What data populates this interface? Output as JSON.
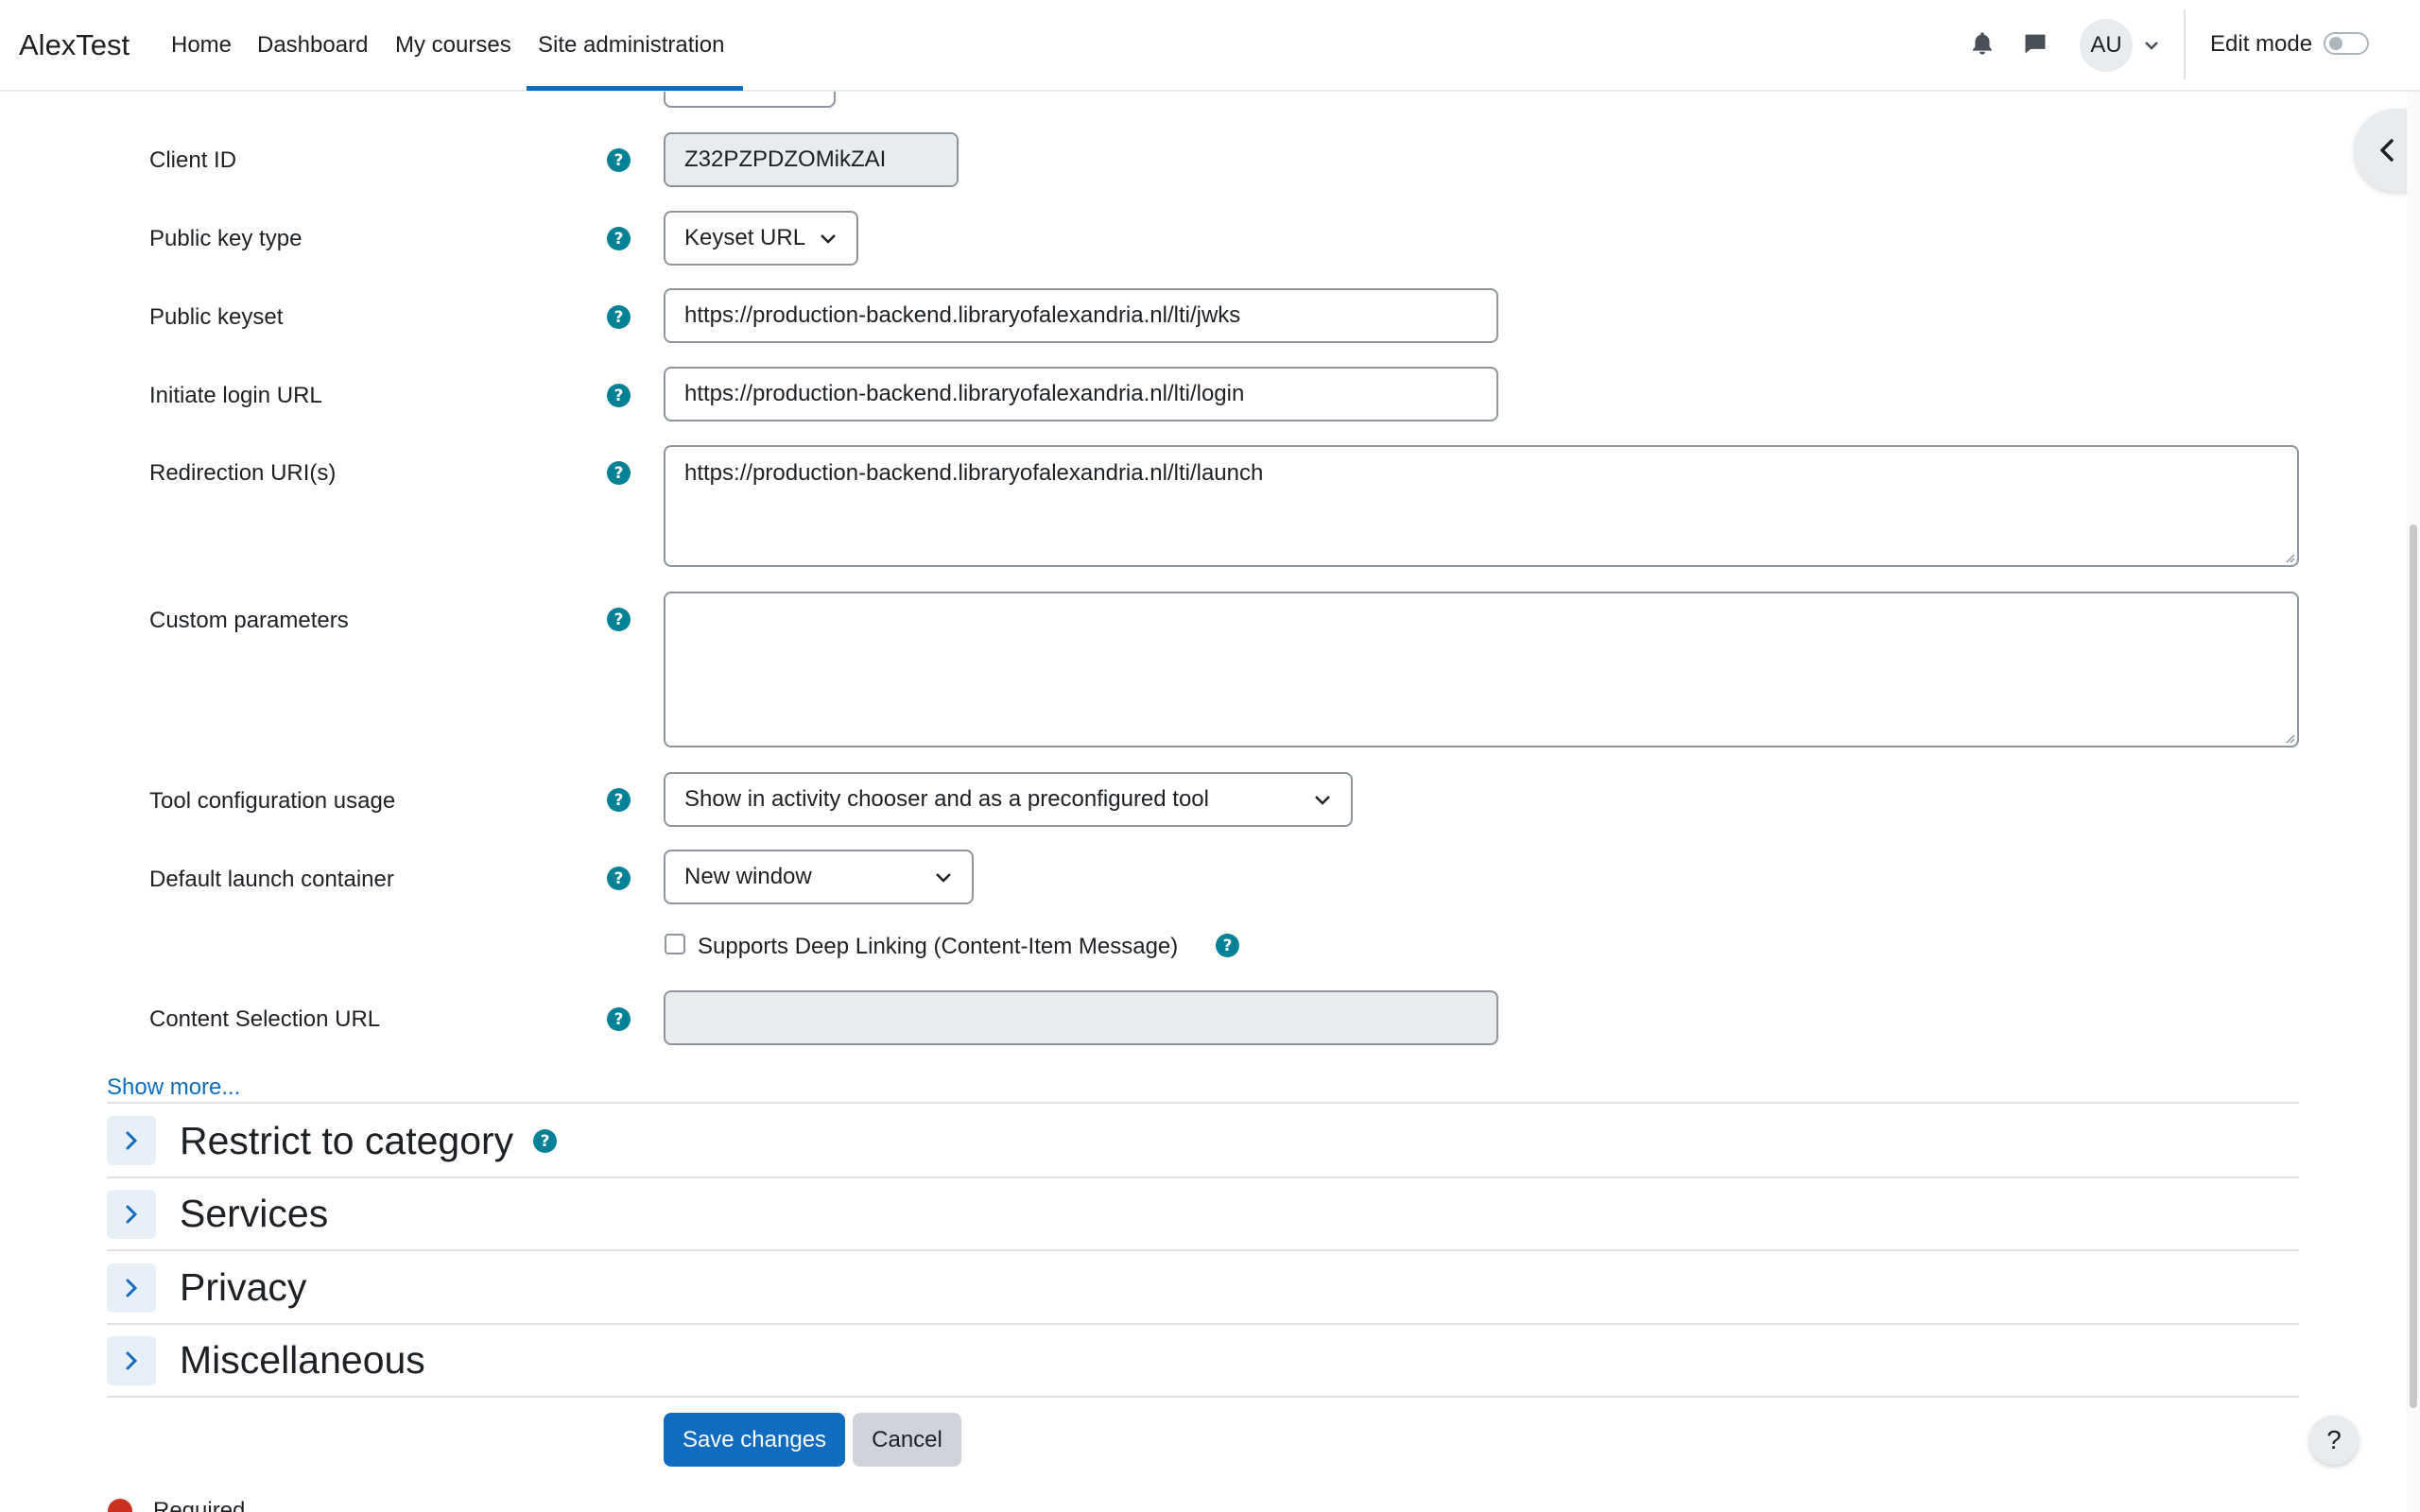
{
  "navbar": {
    "brand": "AlexTest",
    "links": [
      {
        "label": "Home"
      },
      {
        "label": "Dashboard"
      },
      {
        "label": "My courses"
      },
      {
        "label": "Site administration"
      }
    ],
    "avatar_initials": "AU",
    "edit_mode_label": "Edit mode",
    "edit_mode_on": false
  },
  "form": {
    "client_id": {
      "label": "Client ID",
      "value": "Z32PZPDZOMikZAI"
    },
    "public_key_type": {
      "label": "Public key type",
      "value": "Keyset URL"
    },
    "public_keyset": {
      "label": "Public keyset",
      "value": "https://production-backend.libraryofalexandria.nl/lti/jwks"
    },
    "initiate_login_url": {
      "label": "Initiate login URL",
      "value": "https://production-backend.libraryofalexandria.nl/lti/login"
    },
    "redirection_uris": {
      "label": "Redirection URI(s)",
      "value": "https://production-backend.libraryofalexandria.nl/lti/launch"
    },
    "custom_parameters": {
      "label": "Custom parameters",
      "value": ""
    },
    "tool_config_usage": {
      "label": "Tool configuration usage",
      "value": "Show in activity chooser and as a preconfigured tool"
    },
    "default_launch_container": {
      "label": "Default launch container",
      "value": "New window"
    },
    "deep_linking": {
      "label": "Supports Deep Linking (Content-Item Message)",
      "checked": false
    },
    "content_selection_url": {
      "label": "Content Selection URL",
      "value": ""
    },
    "show_more": "Show more..."
  },
  "sections": [
    {
      "title": "Restrict to category"
    },
    {
      "title": "Services"
    },
    {
      "title": "Privacy"
    },
    {
      "title": "Miscellaneous"
    }
  ],
  "actions": {
    "save": "Save changes",
    "cancel": "Cancel"
  },
  "footer": {
    "required": "Required",
    "help_fab": "?"
  },
  "colors": {
    "primary": "#0f6cbf",
    "help_icon": "#008196",
    "required": "#ca3120"
  }
}
